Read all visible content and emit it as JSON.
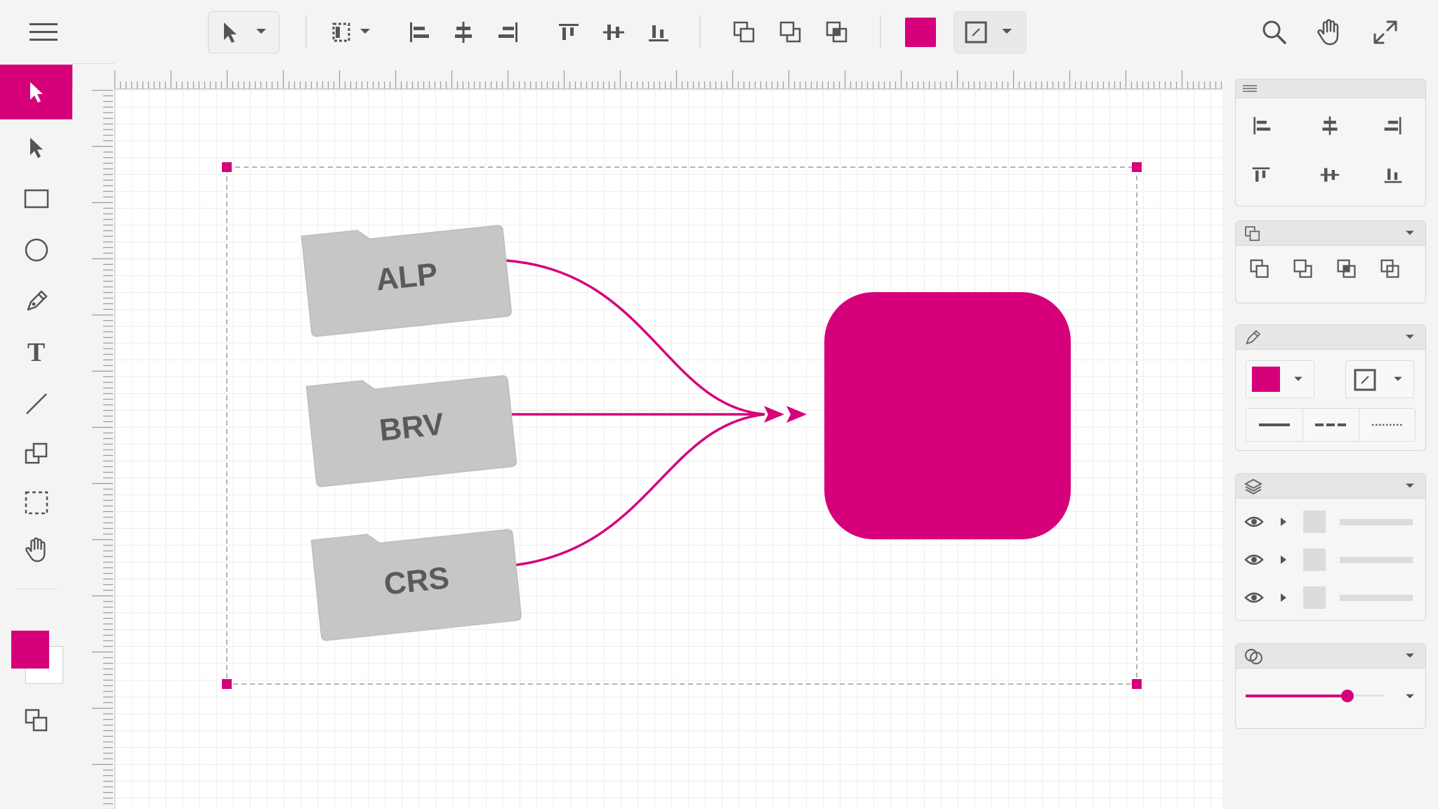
{
  "app": {
    "accent_color": "#d6007a",
    "icons": {
      "toolbar": [
        "menu-icon",
        "pointer-icon",
        "chevron-down-icon",
        "selection-box-icon",
        "align-left-icon",
        "align-center-icon",
        "align-right-icon",
        "align-top-icon",
        "align-middle-icon",
        "align-bottom-icon",
        "bring-forward-icon",
        "send-backward-icon",
        "intersect-icon",
        "fill-color-swatch",
        "stroke-style-icon",
        "search-icon",
        "hand-icon",
        "expand-icon"
      ],
      "tools": [
        "select-tool-icon",
        "direct-select-icon",
        "rectangle-icon",
        "ellipse-icon",
        "pen-icon",
        "text-icon",
        "line-icon",
        "shapes-icon",
        "marquee-icon",
        "hand-icon"
      ]
    }
  },
  "tools": {
    "text_glyph": "T"
  },
  "diagram": {
    "folders": [
      {
        "label": "ALP"
      },
      {
        "label": "BRV"
      },
      {
        "label": "CRS"
      }
    ],
    "target_fill": "#d6007a",
    "connector_color": "#d6007a"
  },
  "panels": {
    "align": {
      "title_icon": "drag-handle-icon"
    },
    "arrange": {
      "title_icon": "arrange-icon"
    },
    "style": {
      "title_icon": "pen-icon",
      "fill_color": "#d6007a"
    },
    "layers": {
      "title_icon": "layers-icon",
      "rows": 3
    },
    "opacity": {
      "title_icon": "blend-icon",
      "value_fraction": 0.74
    }
  }
}
